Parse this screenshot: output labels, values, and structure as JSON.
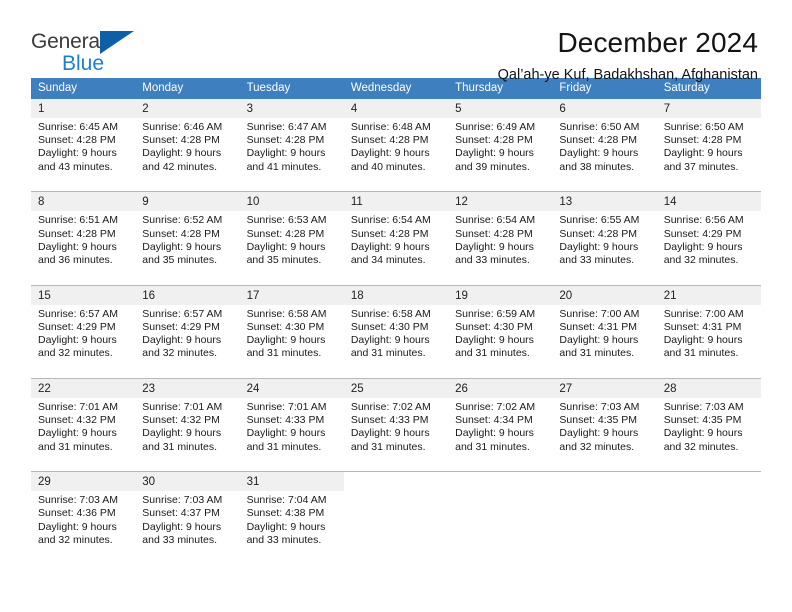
{
  "brand": {
    "name_top": "General",
    "name_bottom": "Blue",
    "triangle_color": "#0e5fa8",
    "blue_color": "#1c7fd1"
  },
  "header": {
    "title": "December 2024",
    "subtitle": "Qal’ah-ye Kuf, Badakhshan, Afghanistan"
  },
  "theme": {
    "header_row_bg": "#3d7fbf",
    "daynum_bg": "#f0f0f0",
    "cell_bg": "#ffffff",
    "separator": "#b9b9b9"
  },
  "weekdays": [
    "Sunday",
    "Monday",
    "Tuesday",
    "Wednesday",
    "Thursday",
    "Friday",
    "Saturday"
  ],
  "weeks": [
    [
      {
        "day": "1",
        "l1": "Sunrise: 6:45 AM",
        "l2": "Sunset: 4:28 PM",
        "l3": "Daylight: 9 hours",
        "l4": "and 43 minutes."
      },
      {
        "day": "2",
        "l1": "Sunrise: 6:46 AM",
        "l2": "Sunset: 4:28 PM",
        "l3": "Daylight: 9 hours",
        "l4": "and 42 minutes."
      },
      {
        "day": "3",
        "l1": "Sunrise: 6:47 AM",
        "l2": "Sunset: 4:28 PM",
        "l3": "Daylight: 9 hours",
        "l4": "and 41 minutes."
      },
      {
        "day": "4",
        "l1": "Sunrise: 6:48 AM",
        "l2": "Sunset: 4:28 PM",
        "l3": "Daylight: 9 hours",
        "l4": "and 40 minutes."
      },
      {
        "day": "5",
        "l1": "Sunrise: 6:49 AM",
        "l2": "Sunset: 4:28 PM",
        "l3": "Daylight: 9 hours",
        "l4": "and 39 minutes."
      },
      {
        "day": "6",
        "l1": "Sunrise: 6:50 AM",
        "l2": "Sunset: 4:28 PM",
        "l3": "Daylight: 9 hours",
        "l4": "and 38 minutes."
      },
      {
        "day": "7",
        "l1": "Sunrise: 6:50 AM",
        "l2": "Sunset: 4:28 PM",
        "l3": "Daylight: 9 hours",
        "l4": "and 37 minutes."
      }
    ],
    [
      {
        "day": "8",
        "l1": "Sunrise: 6:51 AM",
        "l2": "Sunset: 4:28 PM",
        "l3": "Daylight: 9 hours",
        "l4": "and 36 minutes."
      },
      {
        "day": "9",
        "l1": "Sunrise: 6:52 AM",
        "l2": "Sunset: 4:28 PM",
        "l3": "Daylight: 9 hours",
        "l4": "and 35 minutes."
      },
      {
        "day": "10",
        "l1": "Sunrise: 6:53 AM",
        "l2": "Sunset: 4:28 PM",
        "l3": "Daylight: 9 hours",
        "l4": "and 35 minutes."
      },
      {
        "day": "11",
        "l1": "Sunrise: 6:54 AM",
        "l2": "Sunset: 4:28 PM",
        "l3": "Daylight: 9 hours",
        "l4": "and 34 minutes."
      },
      {
        "day": "12",
        "l1": "Sunrise: 6:54 AM",
        "l2": "Sunset: 4:28 PM",
        "l3": "Daylight: 9 hours",
        "l4": "and 33 minutes."
      },
      {
        "day": "13",
        "l1": "Sunrise: 6:55 AM",
        "l2": "Sunset: 4:28 PM",
        "l3": "Daylight: 9 hours",
        "l4": "and 33 minutes."
      },
      {
        "day": "14",
        "l1": "Sunrise: 6:56 AM",
        "l2": "Sunset: 4:29 PM",
        "l3": "Daylight: 9 hours",
        "l4": "and 32 minutes."
      }
    ],
    [
      {
        "day": "15",
        "l1": "Sunrise: 6:57 AM",
        "l2": "Sunset: 4:29 PM",
        "l3": "Daylight: 9 hours",
        "l4": "and 32 minutes."
      },
      {
        "day": "16",
        "l1": "Sunrise: 6:57 AM",
        "l2": "Sunset: 4:29 PM",
        "l3": "Daylight: 9 hours",
        "l4": "and 32 minutes."
      },
      {
        "day": "17",
        "l1": "Sunrise: 6:58 AM",
        "l2": "Sunset: 4:30 PM",
        "l3": "Daylight: 9 hours",
        "l4": "and 31 minutes."
      },
      {
        "day": "18",
        "l1": "Sunrise: 6:58 AM",
        "l2": "Sunset: 4:30 PM",
        "l3": "Daylight: 9 hours",
        "l4": "and 31 minutes."
      },
      {
        "day": "19",
        "l1": "Sunrise: 6:59 AM",
        "l2": "Sunset: 4:30 PM",
        "l3": "Daylight: 9 hours",
        "l4": "and 31 minutes."
      },
      {
        "day": "20",
        "l1": "Sunrise: 7:00 AM",
        "l2": "Sunset: 4:31 PM",
        "l3": "Daylight: 9 hours",
        "l4": "and 31 minutes."
      },
      {
        "day": "21",
        "l1": "Sunrise: 7:00 AM",
        "l2": "Sunset: 4:31 PM",
        "l3": "Daylight: 9 hours",
        "l4": "and 31 minutes."
      }
    ],
    [
      {
        "day": "22",
        "l1": "Sunrise: 7:01 AM",
        "l2": "Sunset: 4:32 PM",
        "l3": "Daylight: 9 hours",
        "l4": "and 31 minutes."
      },
      {
        "day": "23",
        "l1": "Sunrise: 7:01 AM",
        "l2": "Sunset: 4:32 PM",
        "l3": "Daylight: 9 hours",
        "l4": "and 31 minutes."
      },
      {
        "day": "24",
        "l1": "Sunrise: 7:01 AM",
        "l2": "Sunset: 4:33 PM",
        "l3": "Daylight: 9 hours",
        "l4": "and 31 minutes."
      },
      {
        "day": "25",
        "l1": "Sunrise: 7:02 AM",
        "l2": "Sunset: 4:33 PM",
        "l3": "Daylight: 9 hours",
        "l4": "and 31 minutes."
      },
      {
        "day": "26",
        "l1": "Sunrise: 7:02 AM",
        "l2": "Sunset: 4:34 PM",
        "l3": "Daylight: 9 hours",
        "l4": "and 31 minutes."
      },
      {
        "day": "27",
        "l1": "Sunrise: 7:03 AM",
        "l2": "Sunset: 4:35 PM",
        "l3": "Daylight: 9 hours",
        "l4": "and 32 minutes."
      },
      {
        "day": "28",
        "l1": "Sunrise: 7:03 AM",
        "l2": "Sunset: 4:35 PM",
        "l3": "Daylight: 9 hours",
        "l4": "and 32 minutes."
      }
    ],
    [
      {
        "day": "29",
        "l1": "Sunrise: 7:03 AM",
        "l2": "Sunset: 4:36 PM",
        "l3": "Daylight: 9 hours",
        "l4": "and 32 minutes."
      },
      {
        "day": "30",
        "l1": "Sunrise: 7:03 AM",
        "l2": "Sunset: 4:37 PM",
        "l3": "Daylight: 9 hours",
        "l4": "and 33 minutes."
      },
      {
        "day": "31",
        "l1": "Sunrise: 7:04 AM",
        "l2": "Sunset: 4:38 PM",
        "l3": "Daylight: 9 hours",
        "l4": "and 33 minutes."
      },
      {
        "day": "",
        "l1": "",
        "l2": "",
        "l3": "",
        "l4": ""
      },
      {
        "day": "",
        "l1": "",
        "l2": "",
        "l3": "",
        "l4": ""
      },
      {
        "day": "",
        "l1": "",
        "l2": "",
        "l3": "",
        "l4": ""
      },
      {
        "day": "",
        "l1": "",
        "l2": "",
        "l3": "",
        "l4": ""
      }
    ]
  ]
}
